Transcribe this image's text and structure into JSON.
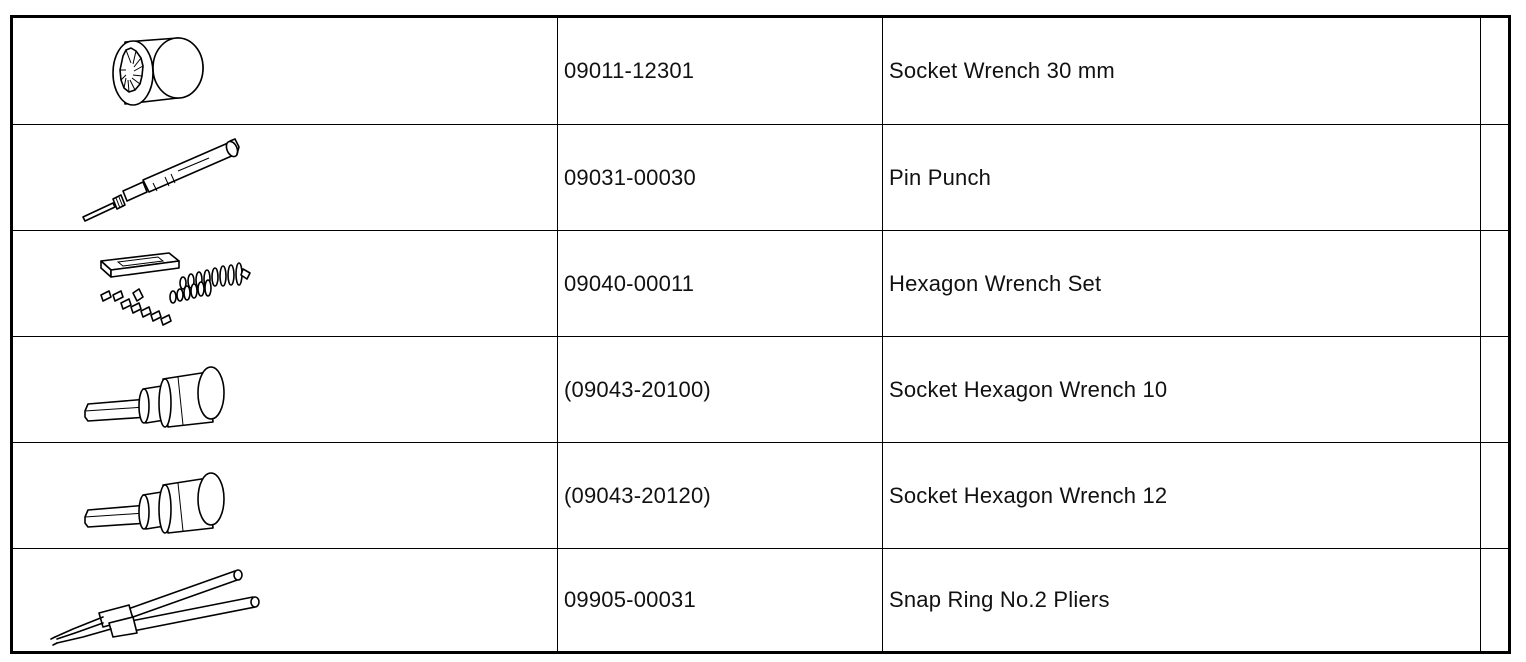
{
  "tools": {
    "rows": [
      {
        "part_number": "09011-12301",
        "name": "Socket Wrench 30 mm",
        "note": "",
        "illustration": "socket-wrench-icon"
      },
      {
        "part_number": "09031-00030",
        "name": "Pin Punch",
        "note": "",
        "illustration": "pin-punch-icon"
      },
      {
        "part_number": "09040-00011",
        "name": "Hexagon Wrench Set",
        "note": "",
        "illustration": "hexagon-wrench-set-icon"
      },
      {
        "part_number": "(09043-20100)",
        "name": "Socket Hexagon Wrench 10",
        "note": "",
        "illustration": "socket-hexagon-wrench-icon"
      },
      {
        "part_number": "(09043-20120)",
        "name": "Socket Hexagon Wrench 12",
        "note": "",
        "illustration": "socket-hexagon-wrench-icon"
      },
      {
        "part_number": "09905-00031",
        "name": "Snap Ring No.2 Pliers",
        "note": "",
        "illustration": "snap-ring-pliers-icon"
      }
    ]
  }
}
